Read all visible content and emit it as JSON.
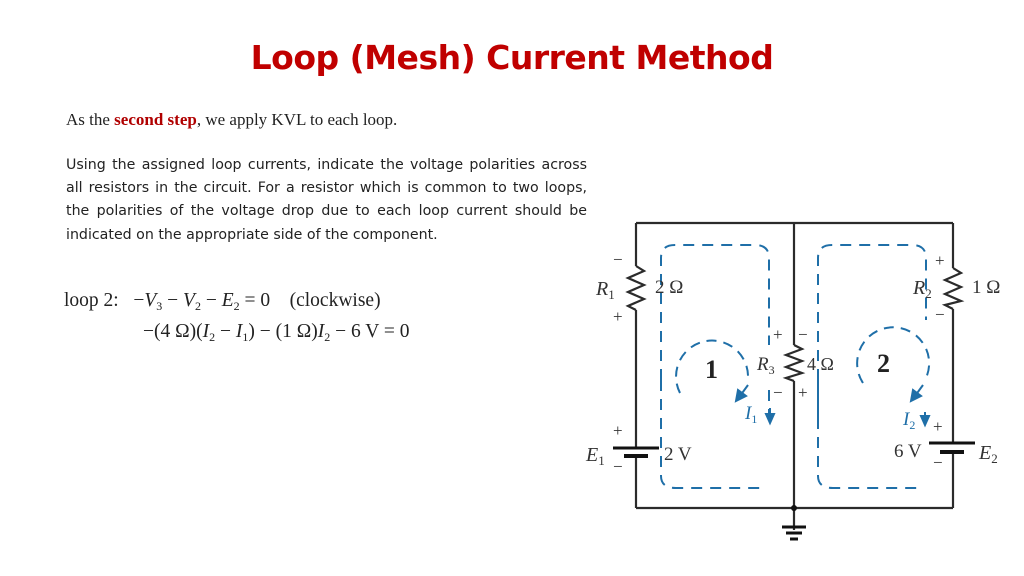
{
  "slide": {
    "title": "Loop (Mesh) Current Method",
    "intro": {
      "prefix": "As the ",
      "highlight": "second step",
      "suffix": ", we apply KVL to each loop."
    },
    "paragraph": "Using the assigned loop currents, indicate the voltage polarities across all resistors in the circuit. For a resistor which is common to two loops, the polarities of the voltage drop due to each loop current should be indicated on the appropriate side of the component.",
    "equations": {
      "loop_label": "loop 2:",
      "line1": {
        "terms": [
          "−",
          "V",
          "3",
          " − ",
          "V",
          "2",
          " − ",
          "E",
          "2",
          " = 0"
        ],
        "note": "(clockwise)"
      },
      "line2": {
        "p1": "−(4 Ω)(",
        "i2a": "I",
        "i2a_sub": "2",
        "minus": " − ",
        "i1": "I",
        "i1_sub": "1",
        "p2": ") − (1 Ω)",
        "i2b": "I",
        "i2b_sub": "2",
        "p3": " − 6 V = 0"
      }
    }
  },
  "circuit": {
    "colors": {
      "wire": "#2b2b2b",
      "loop": "#1f6fa8",
      "label": "#333333"
    },
    "components": {
      "R1": {
        "name": "R",
        "sub": "1",
        "value": "2 Ω",
        "top_polarity": "−",
        "bottom_polarity": "+"
      },
      "R2": {
        "name": "R",
        "sub": "2",
        "value": "1 Ω",
        "top_polarity": "+",
        "bottom_polarity": "−"
      },
      "R3": {
        "name": "R",
        "sub": "3",
        "value": "4 Ω",
        "loop1_top": "+",
        "loop1_bottom": "−",
        "loop2_top": "−",
        "loop2_bottom": "+"
      },
      "E1": {
        "name": "E",
        "sub": "1",
        "value": "2 V",
        "top_polarity": "+",
        "bottom_polarity": "−"
      },
      "E2": {
        "name": "E",
        "sub": "2",
        "value": "6 V",
        "top_polarity": "+",
        "bottom_polarity": "−"
      }
    },
    "loops": [
      {
        "label": "1",
        "current": "I",
        "current_sub": "1",
        "direction": "clockwise"
      },
      {
        "label": "2",
        "current": "I",
        "current_sub": "2",
        "direction": "clockwise"
      }
    ]
  }
}
